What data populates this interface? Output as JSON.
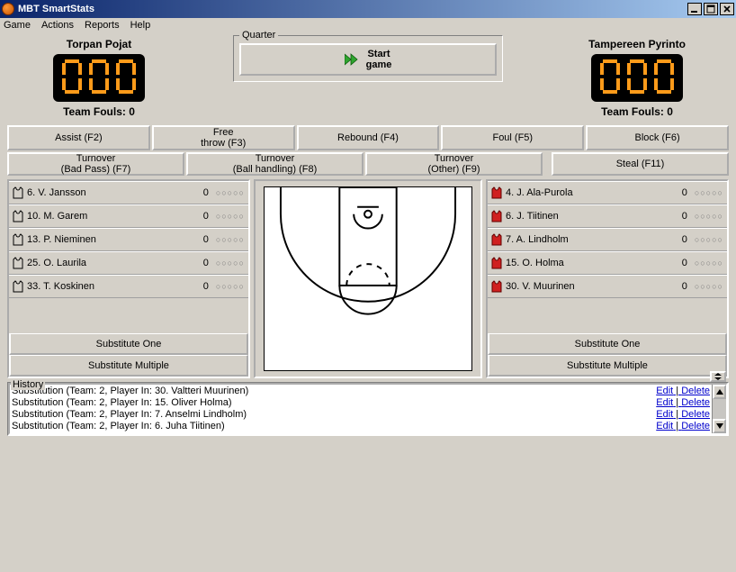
{
  "window": {
    "title": "MBT SmartStats"
  },
  "menu": {
    "game": "Game",
    "actions": "Actions",
    "reports": "Reports",
    "help": "Help"
  },
  "quarter": {
    "legend": "Quarter",
    "start": "Start\ngame"
  },
  "home": {
    "name": "Torpan Pojat",
    "score": "000",
    "fouls_label": "Team Fouls: 0"
  },
  "away": {
    "name": "Tampereen Pyrinto",
    "score": "000",
    "fouls_label": "Team Fouls: 0"
  },
  "actions_row1": {
    "assist": "Assist (F2)",
    "freethrow": "Free\nthrow (F3)",
    "rebound": "Rebound (F4)",
    "foul": "Foul (F5)",
    "block": "Block (F6)"
  },
  "actions_row2": {
    "to_badpass": "Turnover\n(Bad Pass) (F7)",
    "to_ball": "Turnover\n(Ball handling) (F8)",
    "to_other": "Turnover\n(Other) (F9)",
    "steal": "Steal (F11)"
  },
  "home_roster": [
    {
      "label": "6. V. Jansson",
      "pts": "0",
      "dots": "○○○○○"
    },
    {
      "label": "10. M. Garem",
      "pts": "0",
      "dots": "○○○○○"
    },
    {
      "label": "13. P. Nieminen",
      "pts": "0",
      "dots": "○○○○○"
    },
    {
      "label": "25. O. Laurila",
      "pts": "0",
      "dots": "○○○○○"
    },
    {
      "label": "33. T. Koskinen",
      "pts": "0",
      "dots": "○○○○○"
    }
  ],
  "away_roster": [
    {
      "label": "4. J. Ala-Purola",
      "pts": "0",
      "dots": "○○○○○"
    },
    {
      "label": "6. J. Tiitinen",
      "pts": "0",
      "dots": "○○○○○"
    },
    {
      "label": "7. A. Lindholm",
      "pts": "0",
      "dots": "○○○○○"
    },
    {
      "label": "15. O. Holma",
      "pts": "0",
      "dots": "○○○○○"
    },
    {
      "label": "30. V. Muurinen",
      "pts": "0",
      "dots": "○○○○○"
    }
  ],
  "sub": {
    "one": "Substitute One",
    "multi": "Substitute Multiple"
  },
  "history": {
    "legend": "History",
    "edit": "Edit",
    "delete": "Delete",
    "lines": [
      "Substitution (Team: 2, Player In: 30. Valtteri Muurinen)",
      "Substitution (Team: 2, Player In: 15. Oliver Holma)",
      "Substitution (Team: 2, Player In: 7. Anselmi Lindholm)",
      "Substitution (Team: 2, Player In: 6. Juha Tiitinen)"
    ]
  }
}
